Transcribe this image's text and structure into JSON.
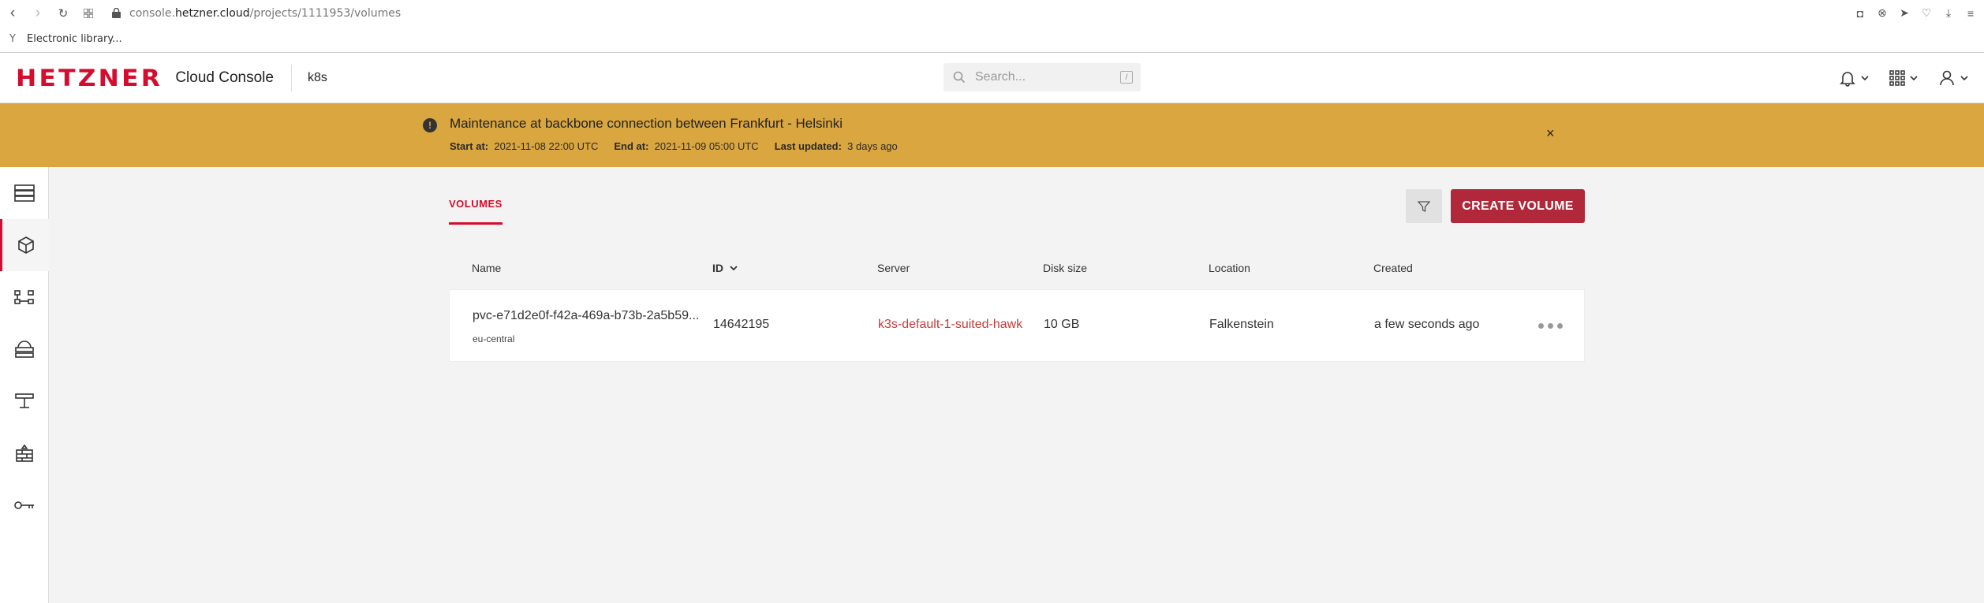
{
  "browser": {
    "url_prefix": "console.",
    "url_domain": "hetzner.cloud",
    "url_path": "/projects/1111953/volumes",
    "bookmark": "Electronic library..."
  },
  "header": {
    "logo": "HETZNER",
    "app_name": "Cloud Console",
    "project": "k8s",
    "search_placeholder": "Search...",
    "search_shortcut": "/"
  },
  "banner": {
    "title": "Maintenance at backbone connection between Frankfurt - Helsinki",
    "start_label": "Start at:",
    "start_value": "2021-11-08 22:00 UTC",
    "end_label": "End at:",
    "end_value": "2021-11-09 05:00 UTC",
    "updated_label": "Last updated:",
    "updated_value": "3 days ago",
    "close": "×",
    "warn": "!"
  },
  "sidebar": {
    "items": [
      {
        "icon": "servers-icon"
      },
      {
        "icon": "volumes-icon",
        "active": true
      },
      {
        "icon": "networks-icon"
      },
      {
        "icon": "load-balancers-icon"
      },
      {
        "icon": "floating-ips-icon"
      },
      {
        "icon": "firewalls-icon"
      },
      {
        "icon": "security-keys-icon"
      }
    ]
  },
  "main": {
    "tab": "VOLUMES",
    "create_button": "CREATE VOLUME",
    "columns": [
      "Name",
      "ID",
      "Server",
      "Disk size",
      "Location",
      "Created"
    ],
    "rows": [
      {
        "name": "pvc-e71d2e0f-f42a-469a-b73b-2a5b59...",
        "region": "eu-central",
        "id": "14642195",
        "server": "k3s-default-1-suited-hawk",
        "disk_size": "10 GB",
        "location": "Falkenstein",
        "created": "a few seconds ago"
      }
    ]
  },
  "colors": {
    "brand": "#d50c2d",
    "banner": "#daa640",
    "button": "#b0283a"
  }
}
